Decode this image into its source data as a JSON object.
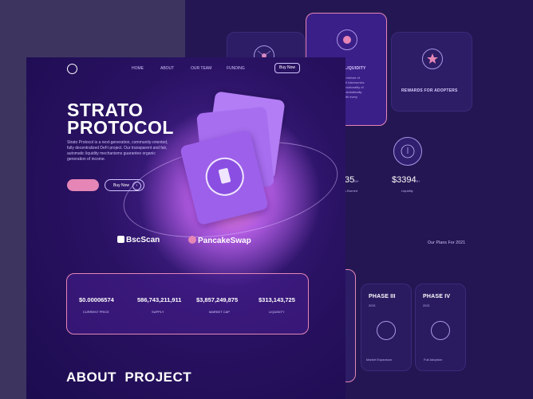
{
  "back": {
    "features": [
      {
        "title": "",
        "icon": "network-icon"
      },
      {
        "title": "LIQUIDITY",
        "icon": "token-icon",
        "desc": "a mixture of\nfull tokenomics\nfunctionality of\nautomatically\nwith every"
      },
      {
        "title": "REWARDS FOR ADOPTERS",
        "icon": "star-badge-icon"
      }
    ],
    "stats": [
      {
        "value": "35",
        "suffix": "M+",
        "label": "s Burned"
      },
      {
        "value": "$3394",
        "suffix": "K+",
        "label": "Liquidity"
      }
    ],
    "plans_title": "Our Plans For 2021",
    "phases": [
      {
        "name": "PHASE III",
        "year": "2021",
        "label": "Market  Expansion"
      },
      {
        "name": "PHASE IV",
        "year": "2021",
        "label": "Full Adoption"
      }
    ]
  },
  "front": {
    "nav": [
      "HOME",
      "ABOUT",
      "OUR TEAM",
      "FUNDING"
    ],
    "buy_nav": "Buy Now",
    "title_line1": "STRATO",
    "title_line2": "PROTOCOL",
    "description": "Strato Protocol is a next-generation, community-oriented, fully decentralized DeFi project. Our transparent and fair, automatic liquidity mechanisms guarantee organic generation of income.",
    "cta_primary": "",
    "cta_secondary": "Buy Now",
    "partners": [
      "BscScan",
      "PancakeSwap"
    ],
    "stats": [
      {
        "value": "$0.00006574",
        "label": "CURRENT PRICE"
      },
      {
        "value": "586,743,211,911",
        "label": "SUPPLY"
      },
      {
        "value": "$3,857,249,875",
        "label": "MARKET CAP"
      },
      {
        "value": "$313,143,725",
        "label": "LIQUIDITY"
      }
    ],
    "about_title": "ABOUT  PROJECT"
  },
  "colors": {
    "accent": "#e586b6",
    "bg": "#1c0c4f",
    "card": "#a46ff0"
  }
}
